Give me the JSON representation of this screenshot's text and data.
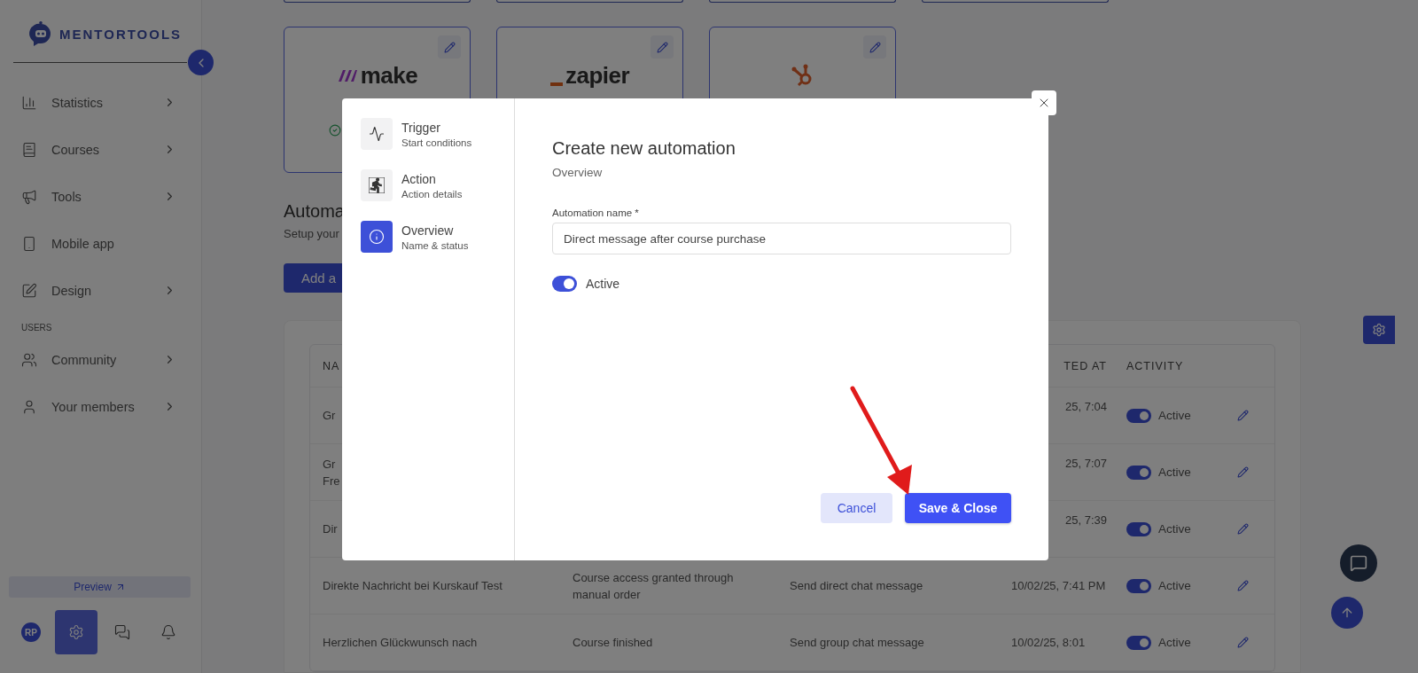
{
  "sidebar": {
    "logo": "MENTORTOOLS",
    "sections": [
      {
        "items": [
          {
            "label": "Statistics",
            "submenu": true
          },
          {
            "label": "Courses",
            "submenu": true
          },
          {
            "label": "Tools",
            "submenu": true
          },
          {
            "label": "Mobile app",
            "submenu": false
          },
          {
            "label": "Design",
            "submenu": true
          }
        ]
      },
      {
        "title": "USERS",
        "items": [
          {
            "label": "Community",
            "submenu": true
          },
          {
            "label": "Your members",
            "submenu": true
          }
        ]
      }
    ],
    "preview": "Preview",
    "avatar": "RP",
    "bottom_buttons": [
      {
        "selected": true
      },
      {
        "selected": false
      },
      {
        "selected": false
      }
    ]
  },
  "main": {
    "integrations": [
      {
        "kind": "make",
        "wordmark": "make",
        "connected": true
      },
      {
        "kind": "zapier",
        "wordmark": "zapier"
      },
      {
        "kind": "hubspot"
      }
    ],
    "section": {
      "title": "Automa",
      "subtitle": "Setup your",
      "button": "Add a"
    },
    "table": {
      "columns": {
        "column_1": "NA",
        "column_4": "TED AT",
        "column_5": "ACTIVITY"
      },
      "rows": [
        {
          "name": "Gr",
          "created": "25, 7:04",
          "active": true,
          "status": "Active"
        },
        {
          "name": "Gr\nFre",
          "created": "25, 7:07",
          "active": true,
          "status": "Active"
        },
        {
          "name": "Dir",
          "created": "25, 7:39",
          "active": true,
          "status": "Active"
        },
        {
          "name": "Direkte Nachricht bei Kurskauf Test",
          "trigger": "Course access granted through manual order",
          "action": "Send direct chat message",
          "created": "10/02/25, 7:41 PM",
          "active": true,
          "status": "Active"
        },
        {
          "name": "Herzlichen Glückwunsch nach",
          "trigger": "Course finished",
          "action": "Send group chat message",
          "created": "10/02/25, 8:01",
          "active": true,
          "status": "Active"
        }
      ]
    }
  },
  "modal": {
    "steps": [
      {
        "title": "Trigger",
        "subtitle": "Start conditions",
        "selected": false
      },
      {
        "title": "Action",
        "subtitle": "Action details",
        "selected": false
      },
      {
        "title": "Overview",
        "subtitle": "Name & status",
        "selected": true
      }
    ],
    "title": "Create new automation",
    "subtitle": "Overview",
    "field": {
      "label": "Automation name *",
      "value": "Direct message after course purchase"
    },
    "toggle": {
      "on": true,
      "label": "Active"
    },
    "buttons": {
      "cancel": "Cancel",
      "save": "Save & Close"
    }
  }
}
